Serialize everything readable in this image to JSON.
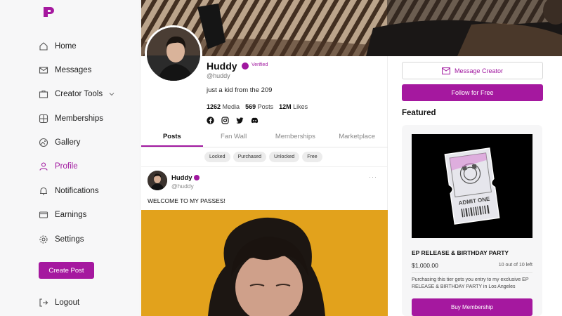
{
  "sidebar": {
    "items": [
      {
        "label": "Home",
        "icon": "home-icon"
      },
      {
        "label": "Messages",
        "icon": "mail-icon"
      },
      {
        "label": "Creator Tools",
        "icon": "briefcase-icon"
      },
      {
        "label": "Memberships",
        "icon": "grid-icon"
      },
      {
        "label": "Gallery",
        "icon": "image-icon"
      },
      {
        "label": "Profile",
        "icon": "user-icon"
      },
      {
        "label": "Notifications",
        "icon": "bell-icon"
      },
      {
        "label": "Earnings",
        "icon": "card-icon"
      },
      {
        "label": "Settings",
        "icon": "gear-icon"
      }
    ],
    "create_post": "Create Post",
    "logout": "Logout"
  },
  "profile": {
    "name": "Huddy",
    "verified": "Verified",
    "handle": "@huddy",
    "bio": "just a kid from the 209",
    "stats": {
      "media_count": "1262",
      "media_label": "Media",
      "posts_count": "569",
      "posts_label": "Posts",
      "likes_count": "12M",
      "likes_label": "Likes"
    }
  },
  "tabs": [
    "Posts",
    "Fan Wall",
    "Memberships",
    "Marketplace"
  ],
  "filters": [
    "Locked",
    "Purchased",
    "Unlocked",
    "Free"
  ],
  "post": {
    "name": "Huddy",
    "handle": "@huddy",
    "text": "WELCOME TO MY PASSES!",
    "more": "···"
  },
  "right": {
    "message": "Message Creator",
    "follow": "Follow for Free",
    "featured": "Featured",
    "card": {
      "ticket_text": "ADMIT ONE",
      "title": "EP RELEASE & BIRTHDAY PARTY",
      "price": "$1,000.00",
      "availability": "10 out of 10 left",
      "description": "Purchasing this tier gets you entry to my exclusive EP RELEASE & BIRTHDAY PARTY in Los Angeles",
      "buy": "Buy Membership"
    }
  },
  "colors": {
    "accent": "#a5189f",
    "media_bg": "#e0a21e"
  }
}
